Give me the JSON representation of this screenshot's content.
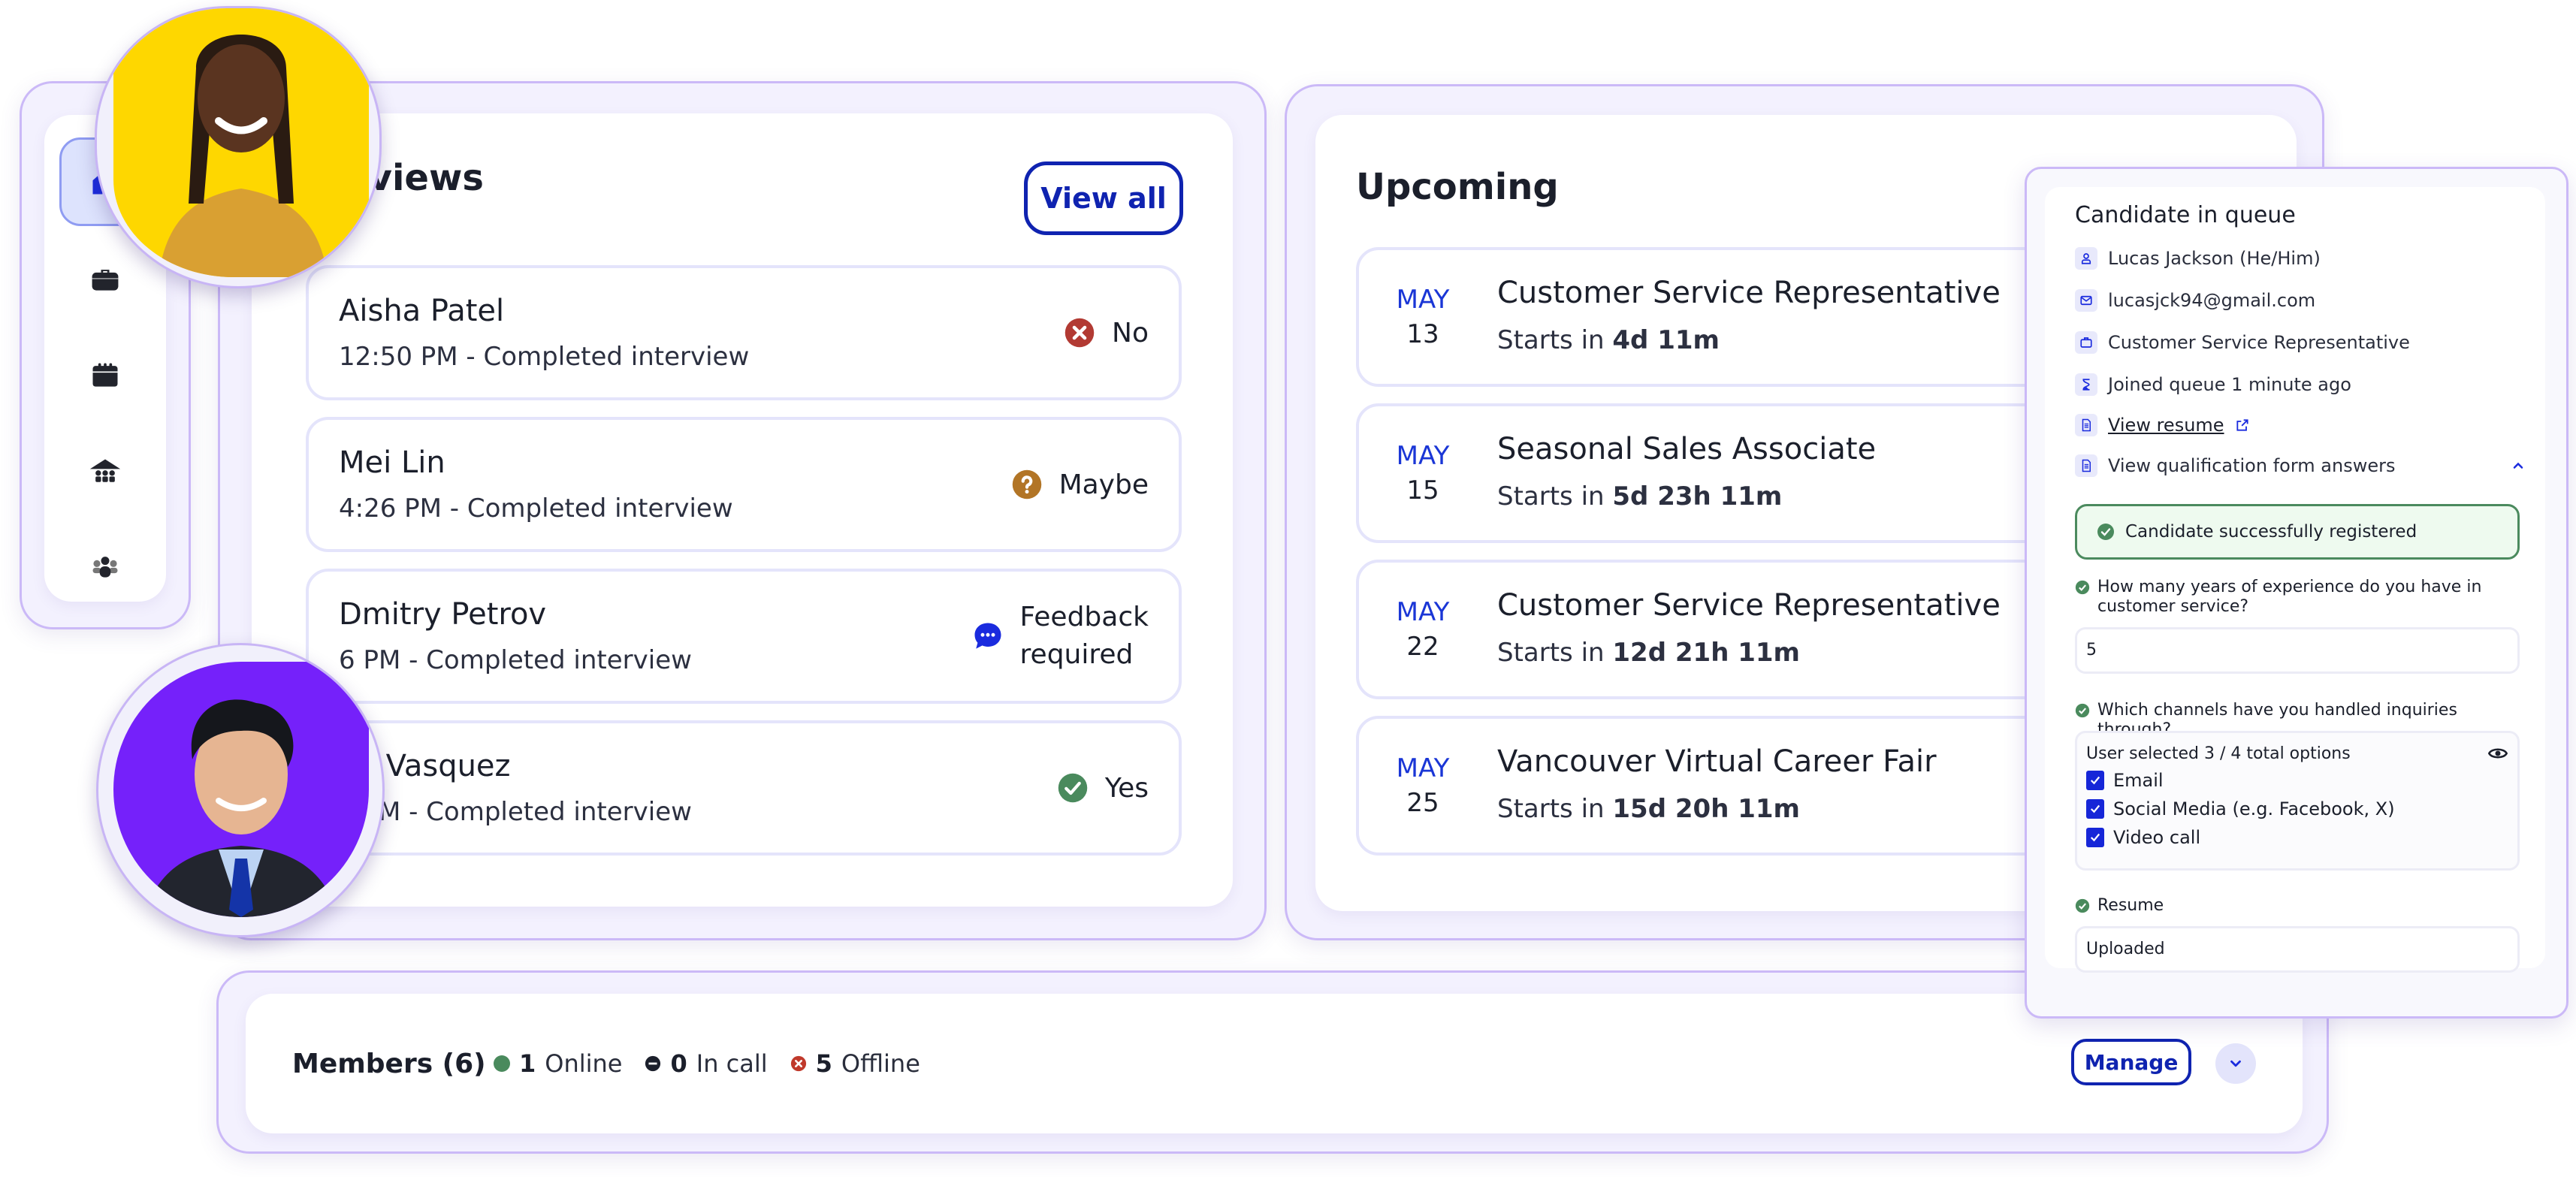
{
  "sidebar": {
    "items": [
      {
        "id": "home",
        "icon": "home-icon",
        "active": true
      },
      {
        "id": "jobs",
        "icon": "briefcase-icon",
        "active": false
      },
      {
        "id": "events",
        "icon": "calendar-icon",
        "active": false
      },
      {
        "id": "fairs",
        "icon": "venue-icon",
        "active": false
      },
      {
        "id": "team",
        "icon": "team-icon",
        "active": false
      }
    ]
  },
  "avatars": [
    {
      "name": "woman-avatar",
      "bg": "#fed700"
    },
    {
      "name": "man-avatar",
      "bg": "#7521fa"
    }
  ],
  "interviews": {
    "title": "Interviews",
    "title_visible": "rviews",
    "view_all_label": "View all",
    "rows": [
      {
        "name": "Aisha Patel",
        "subtitle": "12:50 PM - Completed interview",
        "status": "No",
        "status_icon": "x-circle-icon",
        "status_color": "#b23a33"
      },
      {
        "name": "Mei Lin",
        "subtitle": "4:26 PM - Completed interview",
        "status": "Maybe",
        "status_icon": "question-circle-icon",
        "status_color": "#b27526"
      },
      {
        "name": "Dmitry Petrov",
        "subtitle": "6 PM - Completed interview",
        "status_line1": "Feedback",
        "status_line2": "required",
        "status_icon": "chat-bubble-icon",
        "status_color": "#1a2bde"
      },
      {
        "name": "na Vasquez",
        "subtitle": "3 PM - Completed interview",
        "status": "Yes",
        "status_icon": "check-circle-icon",
        "status_color": "#4a8a5d"
      }
    ]
  },
  "upcoming": {
    "title": "Upcoming",
    "starts_prefix": "Starts in ",
    "rows": [
      {
        "month": "MAY",
        "day": "13",
        "title": "Customer Service Representative",
        "countdown": "4d 11m"
      },
      {
        "month": "MAY",
        "day": "15",
        "title": "Seasonal Sales Associate",
        "countdown": "5d 23h 11m"
      },
      {
        "month": "MAY",
        "day": "22",
        "title": "Customer Service Representative",
        "countdown": "12d 21h 11m"
      },
      {
        "month": "MAY",
        "day": "25",
        "title": "Vancouver Virtual Career Fair",
        "countdown": "15d 20h 11m"
      }
    ]
  },
  "candidate": {
    "title": "Candidate in queue",
    "name": "Lucas Jackson (He/Him)",
    "email": "lucasjck94@gmail.com",
    "position": "Customer Service Representative",
    "joined": "Joined queue 1 minute ago",
    "view_resume": "View resume",
    "view_answers": "View qualification form answers",
    "success_message": "Candidate successfully registered",
    "questions": [
      {
        "label": "How many years of experience do you have in customer service?",
        "answer": "5"
      },
      {
        "label": "Which channels have you handled inquiries through?",
        "summary": "User selected 3 / 4 total options",
        "options": [
          "Email",
          "Social Media (e.g. Facebook, X)",
          "Video call"
        ]
      },
      {
        "label": "Resume",
        "answer": "Uploaded"
      }
    ]
  },
  "members": {
    "title": "Members (6)",
    "online_count": "1",
    "online_label": "Online",
    "incall_count": "0",
    "incall_label": "In call",
    "offline_count": "5",
    "offline_label": "Offline",
    "manage_label": "Manage"
  },
  "colors": {
    "accent": "#0f23b0",
    "panel_bg": "#f3f1fe",
    "panel_border": "#cbb9f7",
    "success": "#4a8a5d",
    "danger": "#b23a33",
    "warning": "#b27526"
  }
}
